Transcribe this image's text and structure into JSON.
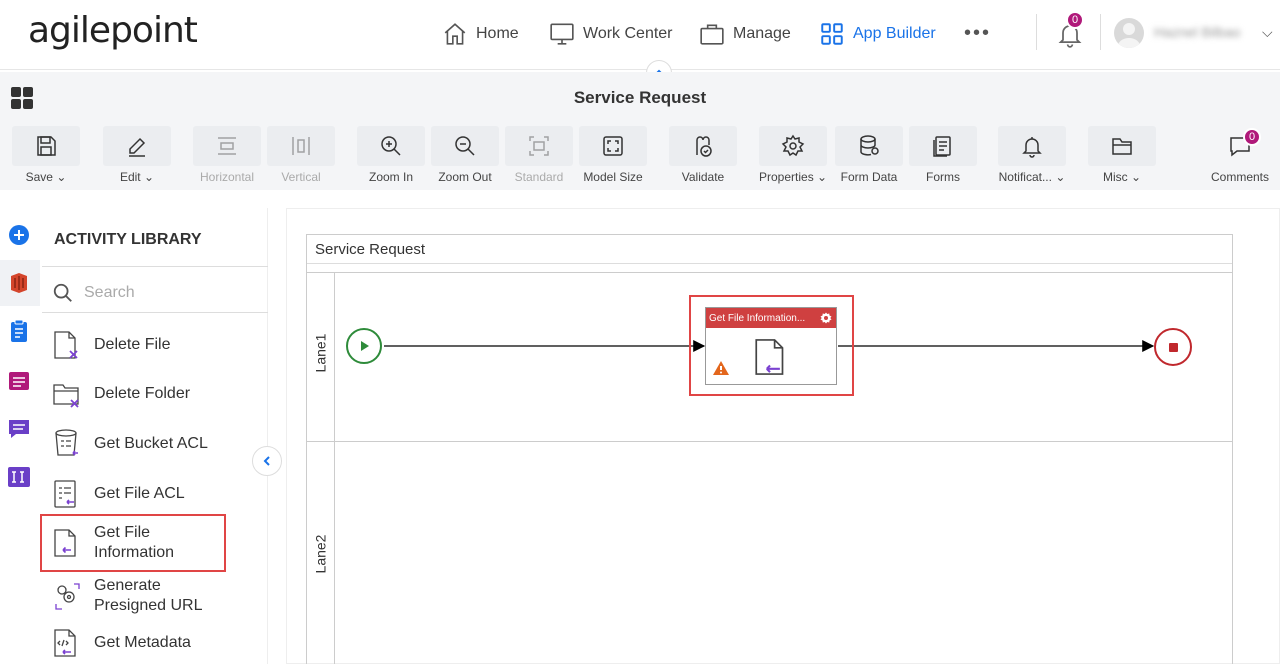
{
  "brand": {
    "logo_text": "agilepoint"
  },
  "nav": {
    "home": "Home",
    "work_center": "Work Center",
    "manage": "Manage",
    "app_builder": "App Builder",
    "more": "•••",
    "notifications_count": "0",
    "user_name": "Haznel Bilbao",
    "accent_color": "#1a73e8"
  },
  "titlebar": {
    "title": "Service Request"
  },
  "toolbar": {
    "save": "Save",
    "edit": "Edit",
    "horizontal": "Horizontal",
    "vertical": "Vertical",
    "zoom_in": "Zoom In",
    "zoom_out": "Zoom Out",
    "standard": "Standard",
    "model_size": "Model Size",
    "validate": "Validate",
    "properties": "Properties",
    "form_data": "Form Data",
    "forms": "Forms",
    "notifications": "Notificat...",
    "misc": "Misc",
    "comments": "Comments",
    "comments_count": "0"
  },
  "library": {
    "title": "ACTIVITY LIBRARY",
    "search_placeholder": "Search",
    "items": [
      {
        "label": "Delete File"
      },
      {
        "label": "Delete Folder"
      },
      {
        "label": "Get Bucket ACL"
      },
      {
        "label": "Get File ACL"
      },
      {
        "label": "Get File Information",
        "line1": "Get File",
        "line2": "Information"
      },
      {
        "label": "Generate Presigned URL",
        "line1": "Generate",
        "line2": "Presigned URL"
      },
      {
        "label": "Get Metadata"
      }
    ]
  },
  "canvas": {
    "pool_title": "Service Request",
    "lanes": [
      "Lane1",
      "Lane2"
    ],
    "activity_title": "Get File Information..."
  }
}
